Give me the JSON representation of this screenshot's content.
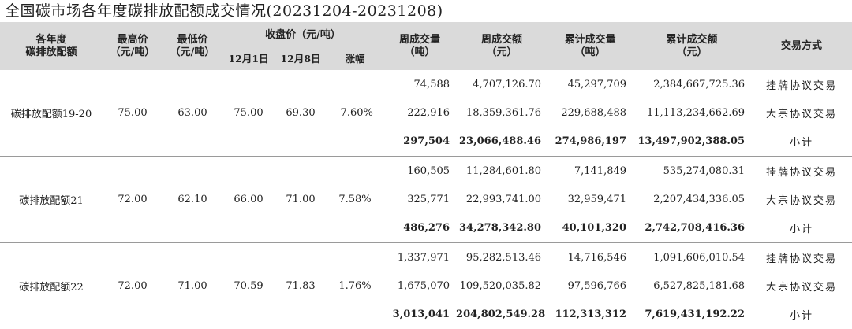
{
  "title": "全国碳市场各年度碳排放配额成交情况(20231204-20231208)",
  "headers": {
    "col1": "各年度\n碳排放配额",
    "high": "最高价\n（元/吨）",
    "low": "最低价\n（元/吨）",
    "close_group": "收盘价（元/吨）",
    "dec1": "12月1日",
    "dec8": "12月8日",
    "change": "涨幅",
    "week_vol": "周成交量\n（吨）",
    "week_amt": "周成交额\n（元）",
    "cum_vol": "累计成交量\n（吨）",
    "cum_amt": "累计成交额\n（元）",
    "method": "交易方式"
  },
  "groups": [
    {
      "name": "碳排放配额19-20",
      "high": "75.00",
      "low": "63.00",
      "dec1": "75.00",
      "dec8": "69.30",
      "change": "-7.60%",
      "rows": [
        {
          "week_vol": "74,588",
          "week_amt": "4,707,126.70",
          "cum_vol": "45,297,709",
          "cum_amt": "2,384,667,725.36",
          "method": "挂牌协议交易"
        },
        {
          "week_vol": "222,916",
          "week_amt": "18,359,361.76",
          "cum_vol": "229,688,488",
          "cum_amt": "11,113,234,662.69",
          "method": "大宗协议交易"
        },
        {
          "week_vol": "297,504",
          "week_amt": "23,066,488.46",
          "cum_vol": "274,986,197",
          "cum_amt": "13,497,902,388.05",
          "method": "小计"
        }
      ]
    },
    {
      "name": "碳排放配额21",
      "high": "72.00",
      "low": "62.10",
      "dec1": "66.00",
      "dec8": "71.00",
      "change": "7.58%",
      "rows": [
        {
          "week_vol": "160,505",
          "week_amt": "11,284,601.80",
          "cum_vol": "7,141,849",
          "cum_amt": "535,274,080.31",
          "method": "挂牌协议交易"
        },
        {
          "week_vol": "325,771",
          "week_amt": "22,993,741.00",
          "cum_vol": "32,959,471",
          "cum_amt": "2,207,434,336.05",
          "method": "大宗协议交易"
        },
        {
          "week_vol": "486,276",
          "week_amt": "34,278,342.80",
          "cum_vol": "40,101,320",
          "cum_amt": "2,742,708,416.36",
          "method": "小计"
        }
      ]
    },
    {
      "name": "碳排放配额22",
      "high": "72.00",
      "low": "71.00",
      "dec1": "70.59",
      "dec8": "71.83",
      "change": "1.76%",
      "rows": [
        {
          "week_vol": "1,337,971",
          "week_amt": "95,282,513.46",
          "cum_vol": "14,716,546",
          "cum_amt": "1,091,606,010.54",
          "method": "挂牌协议交易"
        },
        {
          "week_vol": "1,675,070",
          "week_amt": "109,520,035.82",
          "cum_vol": "97,596,766",
          "cum_amt": "6,527,825,181.68",
          "method": "大宗协议交易"
        },
        {
          "week_vol": "3,013,041",
          "week_amt": "204,802,549.28",
          "cum_vol": "112,313,312",
          "cum_amt": "7,619,431,192.22",
          "method": "小计"
        }
      ]
    }
  ]
}
